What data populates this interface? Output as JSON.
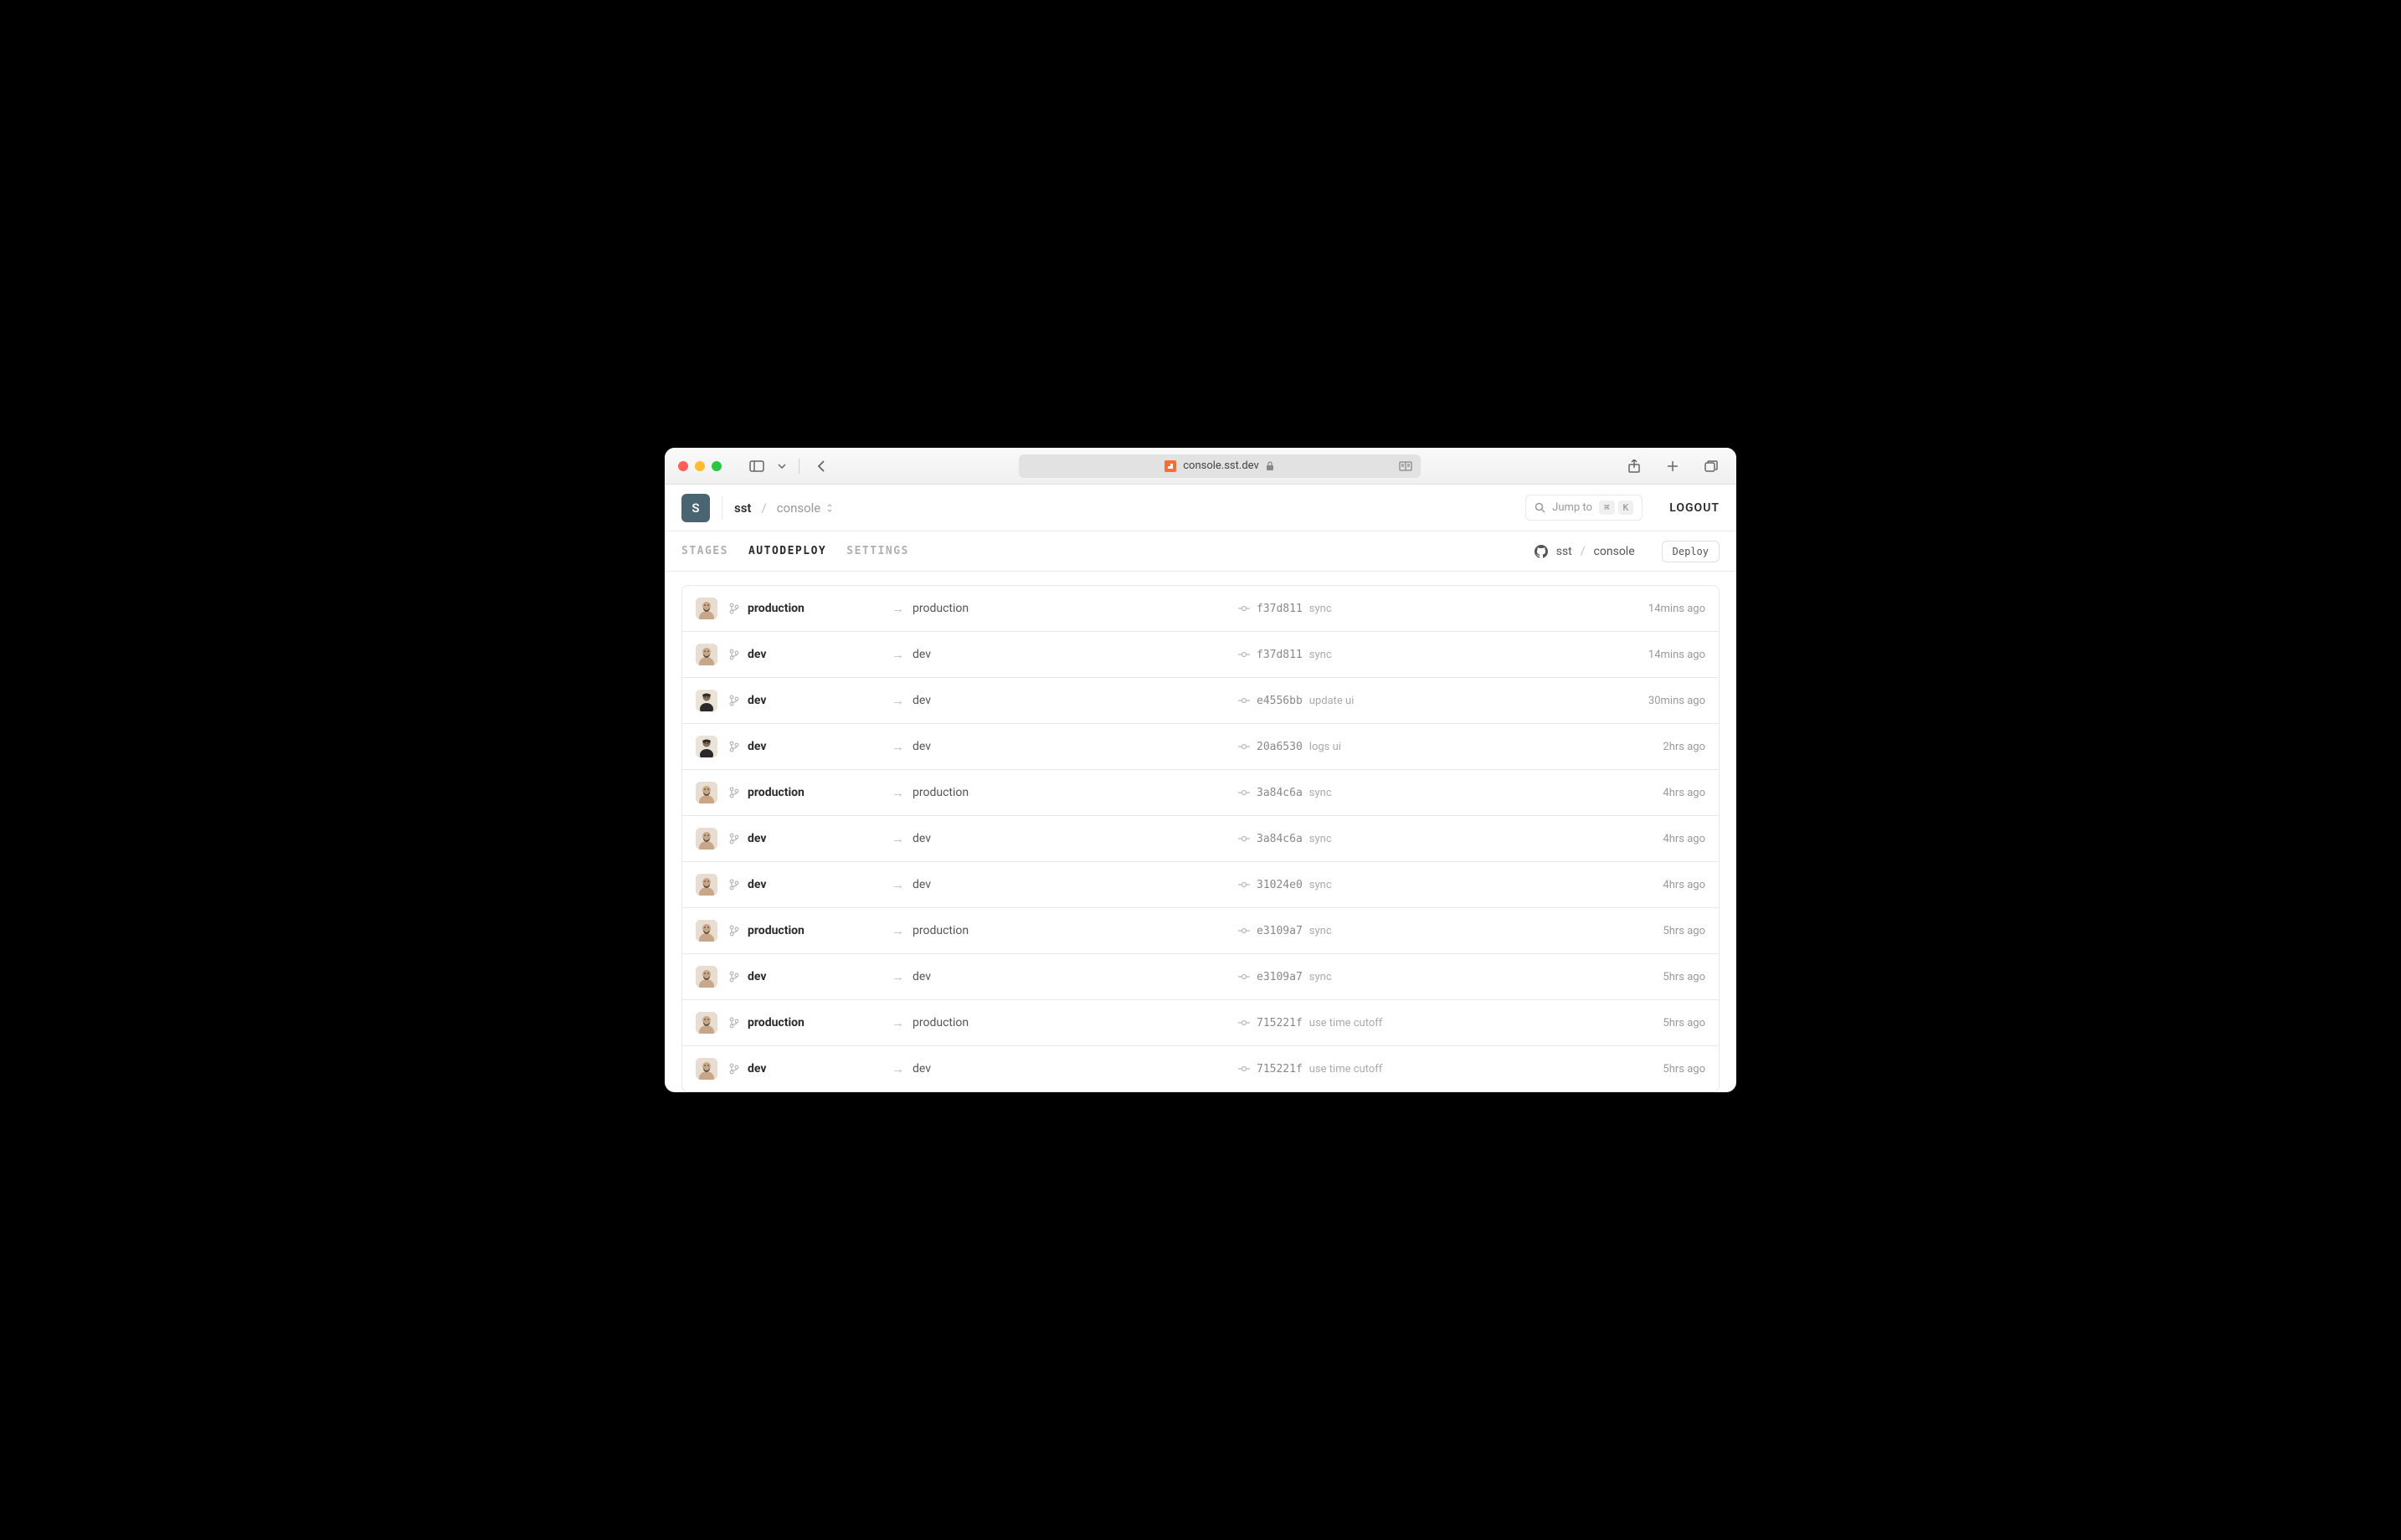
{
  "browser": {
    "url": "console.sst.dev"
  },
  "header": {
    "org_initial": "S",
    "org": "sst",
    "app": "console",
    "jump_placeholder": "Jump to",
    "kbd1": "⌘",
    "kbd2": "K",
    "logout": "LOGOUT"
  },
  "tabs": {
    "stages": "STAGES",
    "autodeploy": "AUTODEPLOY",
    "settings": "SETTINGS"
  },
  "repo": {
    "owner": "sst",
    "name": "console",
    "deploy_label": "Deploy"
  },
  "deploys": [
    {
      "avatar": "a",
      "branch": "production",
      "stage": "production",
      "hash": "f37d811",
      "msg": "sync",
      "time": "14mins ago"
    },
    {
      "avatar": "a",
      "branch": "dev",
      "stage": "dev",
      "hash": "f37d811",
      "msg": "sync",
      "time": "14mins ago"
    },
    {
      "avatar": "b",
      "branch": "dev",
      "stage": "dev",
      "hash": "e4556bb",
      "msg": "update ui",
      "time": "30mins ago"
    },
    {
      "avatar": "b",
      "branch": "dev",
      "stage": "dev",
      "hash": "20a6530",
      "msg": "logs ui",
      "time": "2hrs ago"
    },
    {
      "avatar": "a",
      "branch": "production",
      "stage": "production",
      "hash": "3a84c6a",
      "msg": "sync",
      "time": "4hrs ago"
    },
    {
      "avatar": "a",
      "branch": "dev",
      "stage": "dev",
      "hash": "3a84c6a",
      "msg": "sync",
      "time": "4hrs ago"
    },
    {
      "avatar": "a",
      "branch": "dev",
      "stage": "dev",
      "hash": "31024e0",
      "msg": "sync",
      "time": "4hrs ago"
    },
    {
      "avatar": "a",
      "branch": "production",
      "stage": "production",
      "hash": "e3109a7",
      "msg": "sync",
      "time": "5hrs ago"
    },
    {
      "avatar": "a",
      "branch": "dev",
      "stage": "dev",
      "hash": "e3109a7",
      "msg": "sync",
      "time": "5hrs ago"
    },
    {
      "avatar": "a",
      "branch": "production",
      "stage": "production",
      "hash": "715221f",
      "msg": "use time cutoff",
      "time": "5hrs ago"
    },
    {
      "avatar": "a",
      "branch": "dev",
      "stage": "dev",
      "hash": "715221f",
      "msg": "use time cutoff",
      "time": "5hrs ago"
    }
  ]
}
